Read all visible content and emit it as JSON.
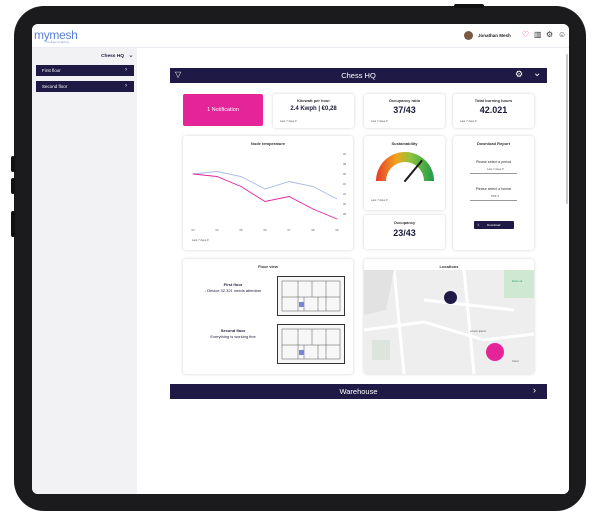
{
  "app": {
    "logo": "mymesh",
    "logo_tagline": "intelligent lighting",
    "user_name": "Jonathan Mesh"
  },
  "sidebar": {
    "title": "Chess HQ",
    "items": [
      {
        "label": "First floor"
      },
      {
        "label": "Second floor"
      }
    ]
  },
  "location": {
    "name": "Chess HQ",
    "next_location": "Warehouse"
  },
  "kpis": {
    "notification": "1 Notification",
    "kwh": {
      "title": "Kilowatt per hour",
      "value": "2.4 Kwph | €0,28",
      "range": "Last 7 days"
    },
    "occupancy_ratio": {
      "title": "Occupancy ratio",
      "value": "37/43",
      "range": "Last 7 days"
    },
    "burning": {
      "title": "Total burning hours",
      "value": "42.021",
      "range": "Last 7 days"
    },
    "occupancy": {
      "title": "Occupancy",
      "value": "23/43"
    }
  },
  "node_temperature": {
    "title": "Node temperature",
    "range": "Last 7 days"
  },
  "sustainability": {
    "title": "Sustainability",
    "range": "Last 7 days",
    "level": 0.72
  },
  "download": {
    "title": "Download Report",
    "period_label": "Please select a period",
    "period_value": "Last 7 days",
    "format_label": "Please select a format",
    "format_value": "PDF",
    "button": "Download"
  },
  "floor_view": {
    "title": "Floor view",
    "floors": [
      {
        "name": "First floor",
        "status": "- Device 32.321 needs attention"
      },
      {
        "name": "Second floor",
        "status": "Everything is working fine"
      }
    ]
  },
  "locations_map": {
    "title": "Locations",
    "labels": [
      "Lorem ipsum",
      "Dolor sit",
      "Amet"
    ]
  },
  "colors": {
    "navy": "#1e1a45",
    "pink": "#e6249a",
    "chart_pink": "#e6249a",
    "chart_blue": "#a9b8e6"
  },
  "chart_data": {
    "type": "line",
    "x": [
      "03",
      "04",
      "05",
      "06",
      "07",
      "08",
      "09"
    ],
    "series": [
      {
        "values": [
          36,
          36.5,
          35.5,
          33,
          34.5,
          33.5,
          31
        ]
      },
      {
        "values": [
          36,
          35.5,
          33.5,
          30.5,
          31.5,
          29,
          27
        ]
      }
    ],
    "y_ticks": [
      "28",
      "30",
      "32",
      "34",
      "36",
      "38",
      "40"
    ],
    "ylim": [
      26,
      40
    ],
    "grid": false
  }
}
